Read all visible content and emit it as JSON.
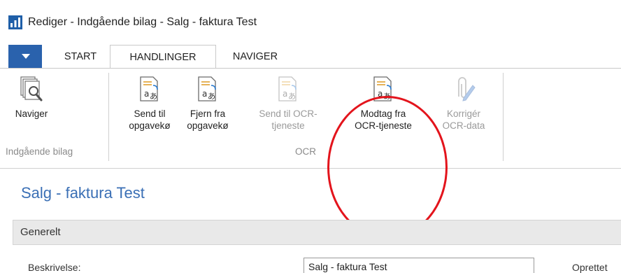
{
  "window": {
    "title": "Rediger - Indgående bilag - Salg - faktura Test",
    "app_icon": "nav-chart-icon"
  },
  "tabs": [
    {
      "label": "START"
    },
    {
      "label": "HANDLINGER",
      "active": true
    },
    {
      "label": "NAVIGER"
    }
  ],
  "ribbon": {
    "groups": [
      {
        "label": "Indgående bilag",
        "buttons": [
          {
            "label": "Naviger",
            "icon": "document-search-icon",
            "enabled": true
          }
        ]
      },
      {
        "label": "OCR",
        "buttons": [
          {
            "label": "Send til\nopgavekø",
            "icon": "translate-document-icon",
            "enabled": true
          },
          {
            "label": "Fjern fra\nopgavekø",
            "icon": "translate-document-icon",
            "enabled": true
          },
          {
            "label": "Send til OCR-\ntjeneste",
            "icon": "translate-document-icon",
            "enabled": false
          },
          {
            "label": "Modtag fra\nOCR-tjeneste",
            "icon": "translate-document-icon",
            "enabled": true
          },
          {
            "label": "Korrigér\nOCR-data",
            "icon": "paperclip-pencil-icon",
            "enabled": false
          }
        ]
      }
    ]
  },
  "annotation_color": "#e3141c",
  "page": {
    "title": "Salg - faktura Test",
    "section_title": "Generelt",
    "fields": [
      {
        "label": "Beskrivelse:",
        "value": "Salg - faktura Test"
      },
      {
        "label": "Oprettet"
      }
    ]
  }
}
